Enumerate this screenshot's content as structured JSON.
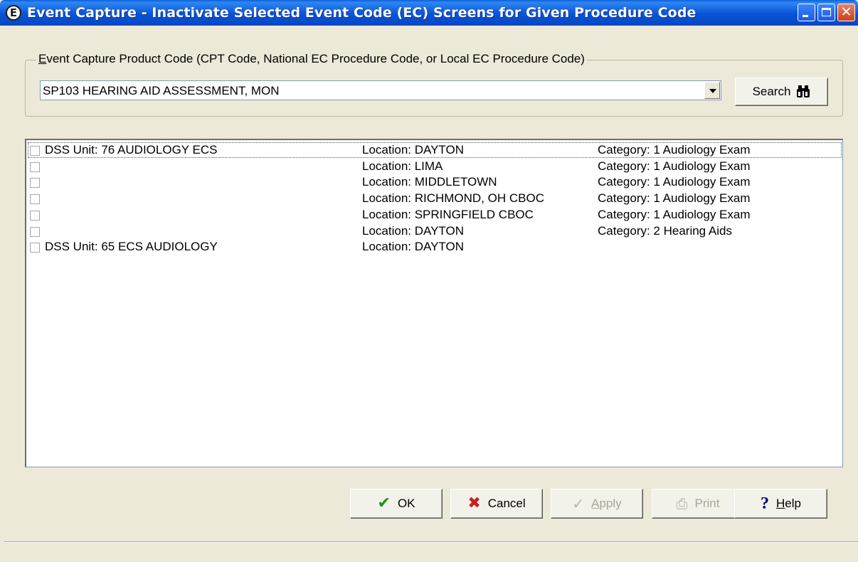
{
  "window": {
    "title": "Event Capture - Inactivate Selected Event Code (EC) Screens for Given Procedure Code",
    "app_icon_glyph": "E",
    "minimize_icon": "minimize-icon",
    "maximize_icon": "maximize-icon",
    "close_glyph": "✕"
  },
  "product_code": {
    "group_label_accel": "E",
    "group_label_rest": "vent Capture Product Code (CPT Code, National EC Procedure Code, or Local EC Procedure Code)",
    "selected_value": "SP103  HEARING AID ASSESSMENT, MON",
    "search_label": "Search",
    "search_icon": "binoculars-icon",
    "search_glyph": "👁"
  },
  "list": {
    "rows": [
      {
        "checked": false,
        "dss_unit": "DSS Unit: 76 AUDIOLOGY ECS",
        "location": "Location: DAYTON",
        "category": "Category: 1 Audiology Exam"
      },
      {
        "checked": false,
        "dss_unit": "",
        "location": "Location: LIMA",
        "category": "Category: 1 Audiology Exam"
      },
      {
        "checked": false,
        "dss_unit": "",
        "location": "Location: MIDDLETOWN",
        "category": "Category: 1 Audiology Exam"
      },
      {
        "checked": false,
        "dss_unit": "",
        "location": "Location: RICHMOND, OH CBOC",
        "category": "Category: 1 Audiology Exam"
      },
      {
        "checked": false,
        "dss_unit": "",
        "location": "Location: SPRINGFIELD CBOC",
        "category": "Category: 1 Audiology Exam"
      },
      {
        "checked": false,
        "dss_unit": "",
        "location": "Location: DAYTON",
        "category": "Category: 2 Hearing Aids"
      },
      {
        "checked": false,
        "dss_unit": "DSS Unit: 65 ECS AUDIOLOGY",
        "location": "Location: DAYTON",
        "category": ""
      }
    ]
  },
  "buttons": {
    "ok": {
      "label": "OK",
      "icon": "checkmark-icon",
      "glyph": "✔",
      "enabled": true
    },
    "cancel": {
      "label": "Cancel",
      "icon": "x-icon",
      "glyph": "✖",
      "enabled": true
    },
    "apply": {
      "label": "Apply",
      "accel": "A",
      "rest": "pply",
      "icon": "apply-check-icon",
      "glyph": "✓",
      "enabled": false
    },
    "print": {
      "label": "Print",
      "accel": "P",
      "rest": "rint",
      "icon": "printer-icon",
      "glyph": "⎙",
      "enabled": false
    },
    "help": {
      "label": "Help",
      "accel": "H",
      "rest": "elp",
      "icon": "question-icon",
      "glyph": "?",
      "enabled": true
    }
  },
  "colors": {
    "titlebar": "#0a53d6",
    "dialog_bg": "#ece9d8",
    "ok_icon": "#1f8f1f",
    "cancel_icon": "#cc1d1d",
    "help_icon": "#00007f"
  }
}
